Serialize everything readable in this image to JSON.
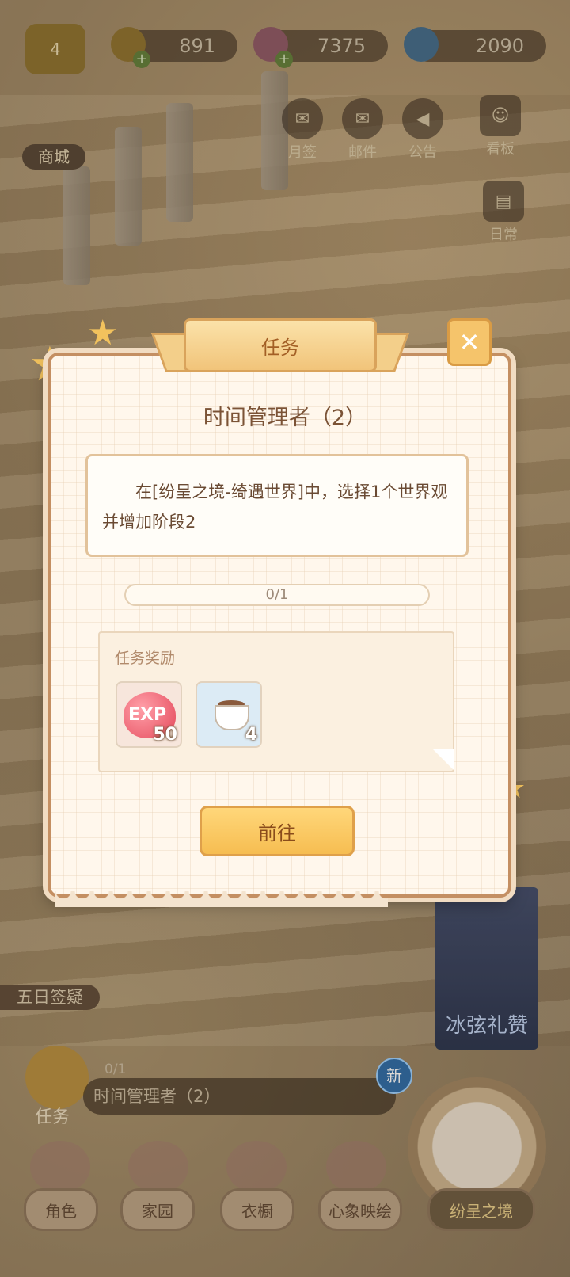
{
  "top_bar": {
    "level": "4",
    "resources": [
      {
        "name": "bell",
        "value": "891",
        "has_plus": true
      },
      {
        "name": "gem",
        "value": "7375",
        "has_plus": true
      },
      {
        "name": "snowflake",
        "value": "2090",
        "has_plus": false
      }
    ],
    "buttons": {
      "monthly": "月签",
      "mail": "邮件",
      "notice": "公告",
      "board": "看板",
      "daily": "日常"
    },
    "shop": "商城"
  },
  "dialog": {
    "header": "任务",
    "task_title": "时间管理者（2）",
    "description": "在[纷呈之境-绮遇世界]中，选择1个世界观并增加阶段2",
    "progress_text": "0/1",
    "progress_fraction": 0,
    "reward_title": "任务奖励",
    "rewards": [
      {
        "icon": "exp-icon",
        "label": "EXP",
        "count": "50"
      },
      {
        "icon": "coffee-icon",
        "count": "4"
      }
    ],
    "go_button": "前往",
    "close_icon": "close-icon"
  },
  "bottom": {
    "event_tag": "五日签疑",
    "poster_text": "冰弦礼赞",
    "tasks_label": "任务",
    "track_progress": "0/1",
    "track_title": "时间管理者（2）",
    "new_badge": "新",
    "nav": [
      "角色",
      "家园",
      "衣橱",
      "心象映绘",
      "纷呈之境"
    ]
  }
}
